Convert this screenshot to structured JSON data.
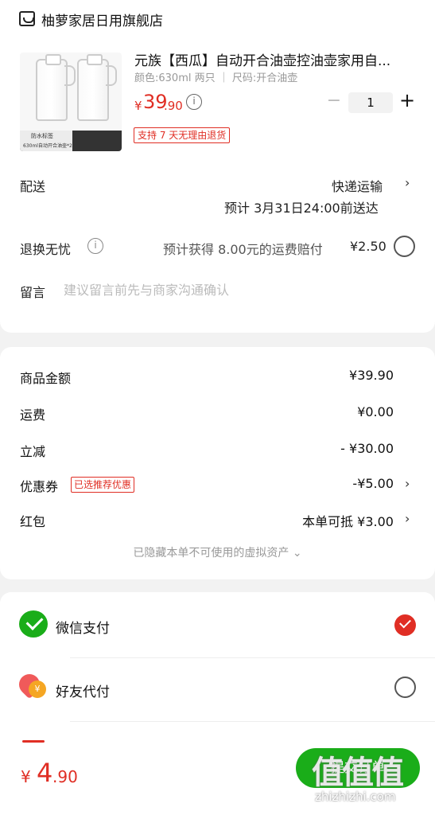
{
  "store": {
    "name": "柚萝家居日用旗舰店"
  },
  "product": {
    "title": "元族【西瓜】自动开合油壶控油壶家用自...",
    "spec": "颜色:630ml 两只 ｜ 尺码:开合油壶",
    "price_currency": "¥",
    "price_int": "39",
    "price_dec": ".90",
    "quantity": "1",
    "return_tag": "支持 7 天无理由退货",
    "image_banner_line1": "防水标签",
    "image_banner_line2": "630ml自动开合油壶*2"
  },
  "delivery": {
    "label": "配送",
    "method": "快递运输",
    "eta": "预计 3月31日24:00前送达"
  },
  "return_service": {
    "label": "退换无忧",
    "desc": "预计获得 8.00元的运费赔付",
    "price": "¥2.50"
  },
  "note": {
    "label": "留言",
    "placeholder": "建议留言前先与商家沟通确认"
  },
  "summary": {
    "goods_label": "商品金额",
    "goods_value": "¥39.90",
    "shipping_label": "运费",
    "shipping_value": "¥0.00",
    "discount_label": "立减",
    "discount_value": "- ¥30.00",
    "coupon_label": "优惠券",
    "coupon_tag": "已选推荐优惠",
    "coupon_value": "-¥5.00",
    "redpacket_label": "红包",
    "redpacket_value": "本单可抵 ¥3.00",
    "hidden_assets": "已隐藏本单不可使用的虚拟资产 ⌄"
  },
  "payment": {
    "wechat_label": "微信支付",
    "friend_label": "好友代付"
  },
  "bottom": {
    "total_currency": "¥",
    "total_int": "4",
    "total_dec": ".90",
    "submit_label": "提交订单",
    "watermark": "值值值",
    "watermark_site": "zhizhizhi.com"
  },
  "colors": {
    "accent_red": "#e02e24",
    "wechat_green": "#1aad19"
  },
  "icons": [
    "store-icon",
    "info-icon",
    "chevron-right-icon",
    "wechat-pay-icon",
    "friend-pay-icon",
    "check-icon"
  ]
}
